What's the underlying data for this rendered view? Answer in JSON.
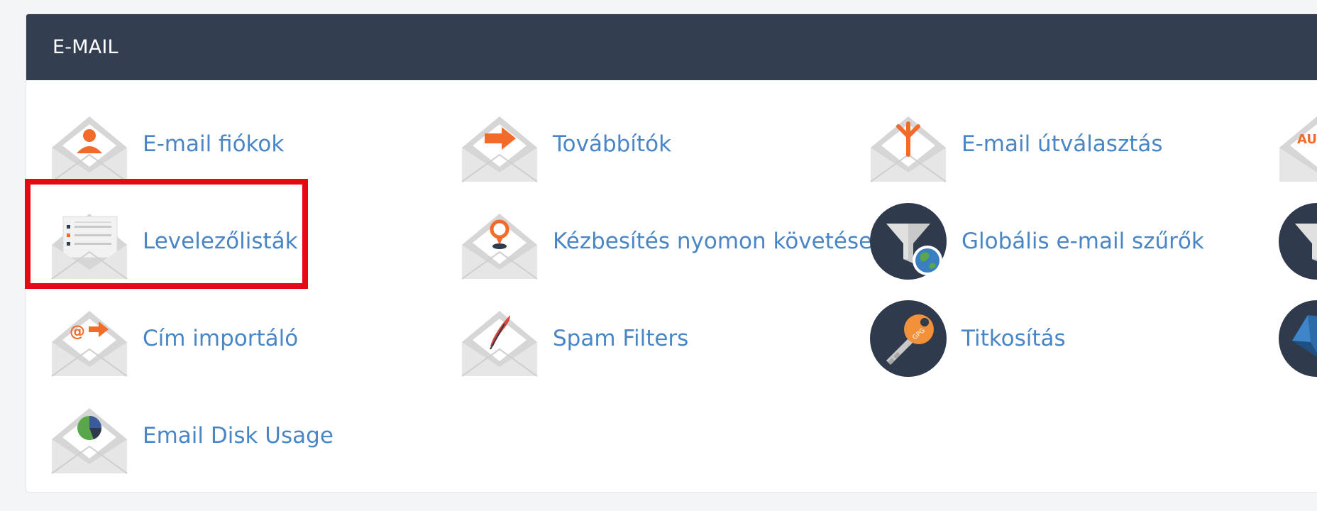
{
  "section": {
    "title": "E-MAIL"
  },
  "items": {
    "email_accounts": "E-mail fiókok",
    "forwarders": "Továbbítók",
    "email_routing": "E-mail útválasztás",
    "mailing_lists": "Levelezőlisták",
    "track_delivery": "Kézbesítés nyomon követése",
    "global_filters": "Globális e-mail szűrők",
    "address_importer": "Cím importáló",
    "spam_filters": "Spam Filters",
    "encryption": "Titkosítás",
    "disk_usage": "Email Disk Usage",
    "autoresponder_icon_text": "AU"
  },
  "colors": {
    "header_bg": "#333f50",
    "link": "#4a86c5",
    "accent_orange": "#f26b2a",
    "highlight_red": "#e50914",
    "dark_circle": "#2f3b4d"
  }
}
